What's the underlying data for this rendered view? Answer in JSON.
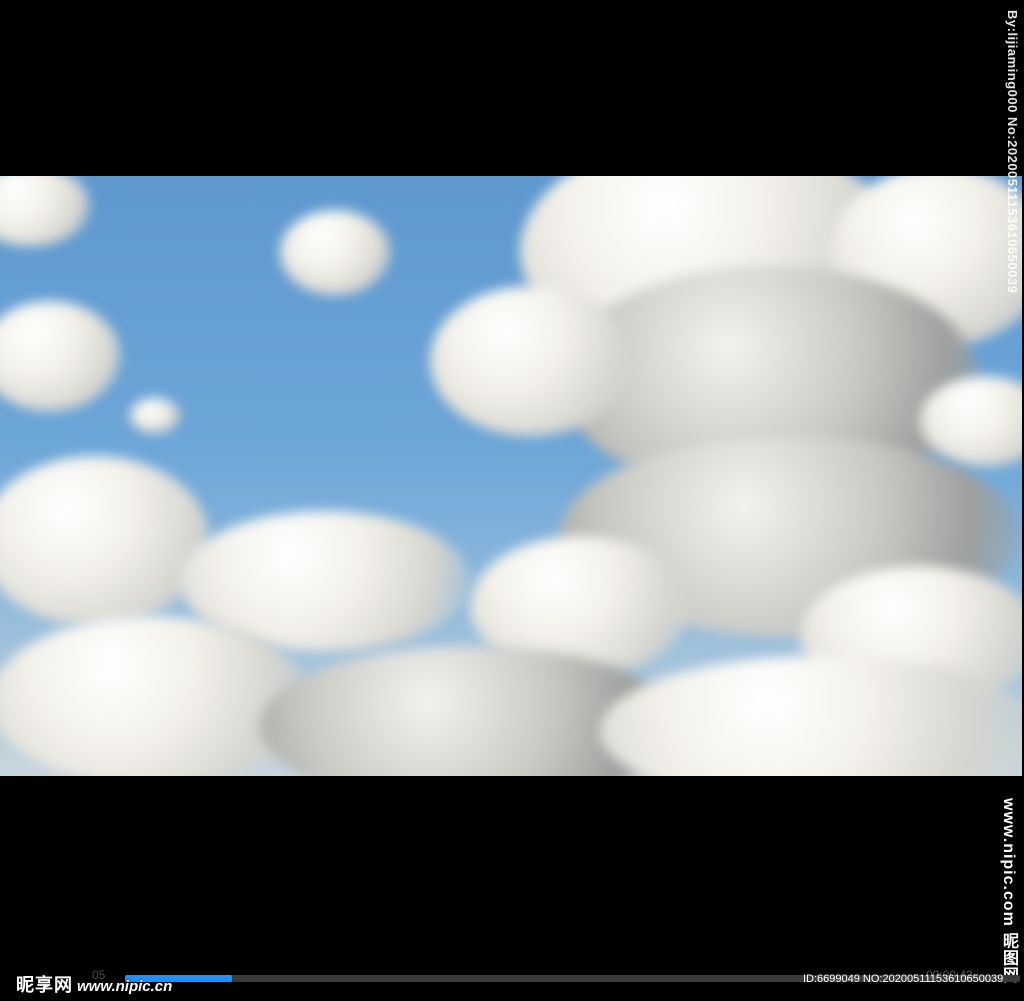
{
  "watermark": {
    "side_top": "By:lijiaming000 No:20200511153610650039",
    "side_bottom": "www.nipic.com",
    "side_bottom_cn": "昵图网"
  },
  "player": {
    "brand_cn": "昵享网",
    "brand_site": "www.nipic.cn",
    "left_faint": "05",
    "id_text": "ID:6699049 NO:20200511153610650039",
    "time_faint": "00:00:42",
    "progress_fraction": 0.12,
    "accent_color": "#1e90ff"
  }
}
